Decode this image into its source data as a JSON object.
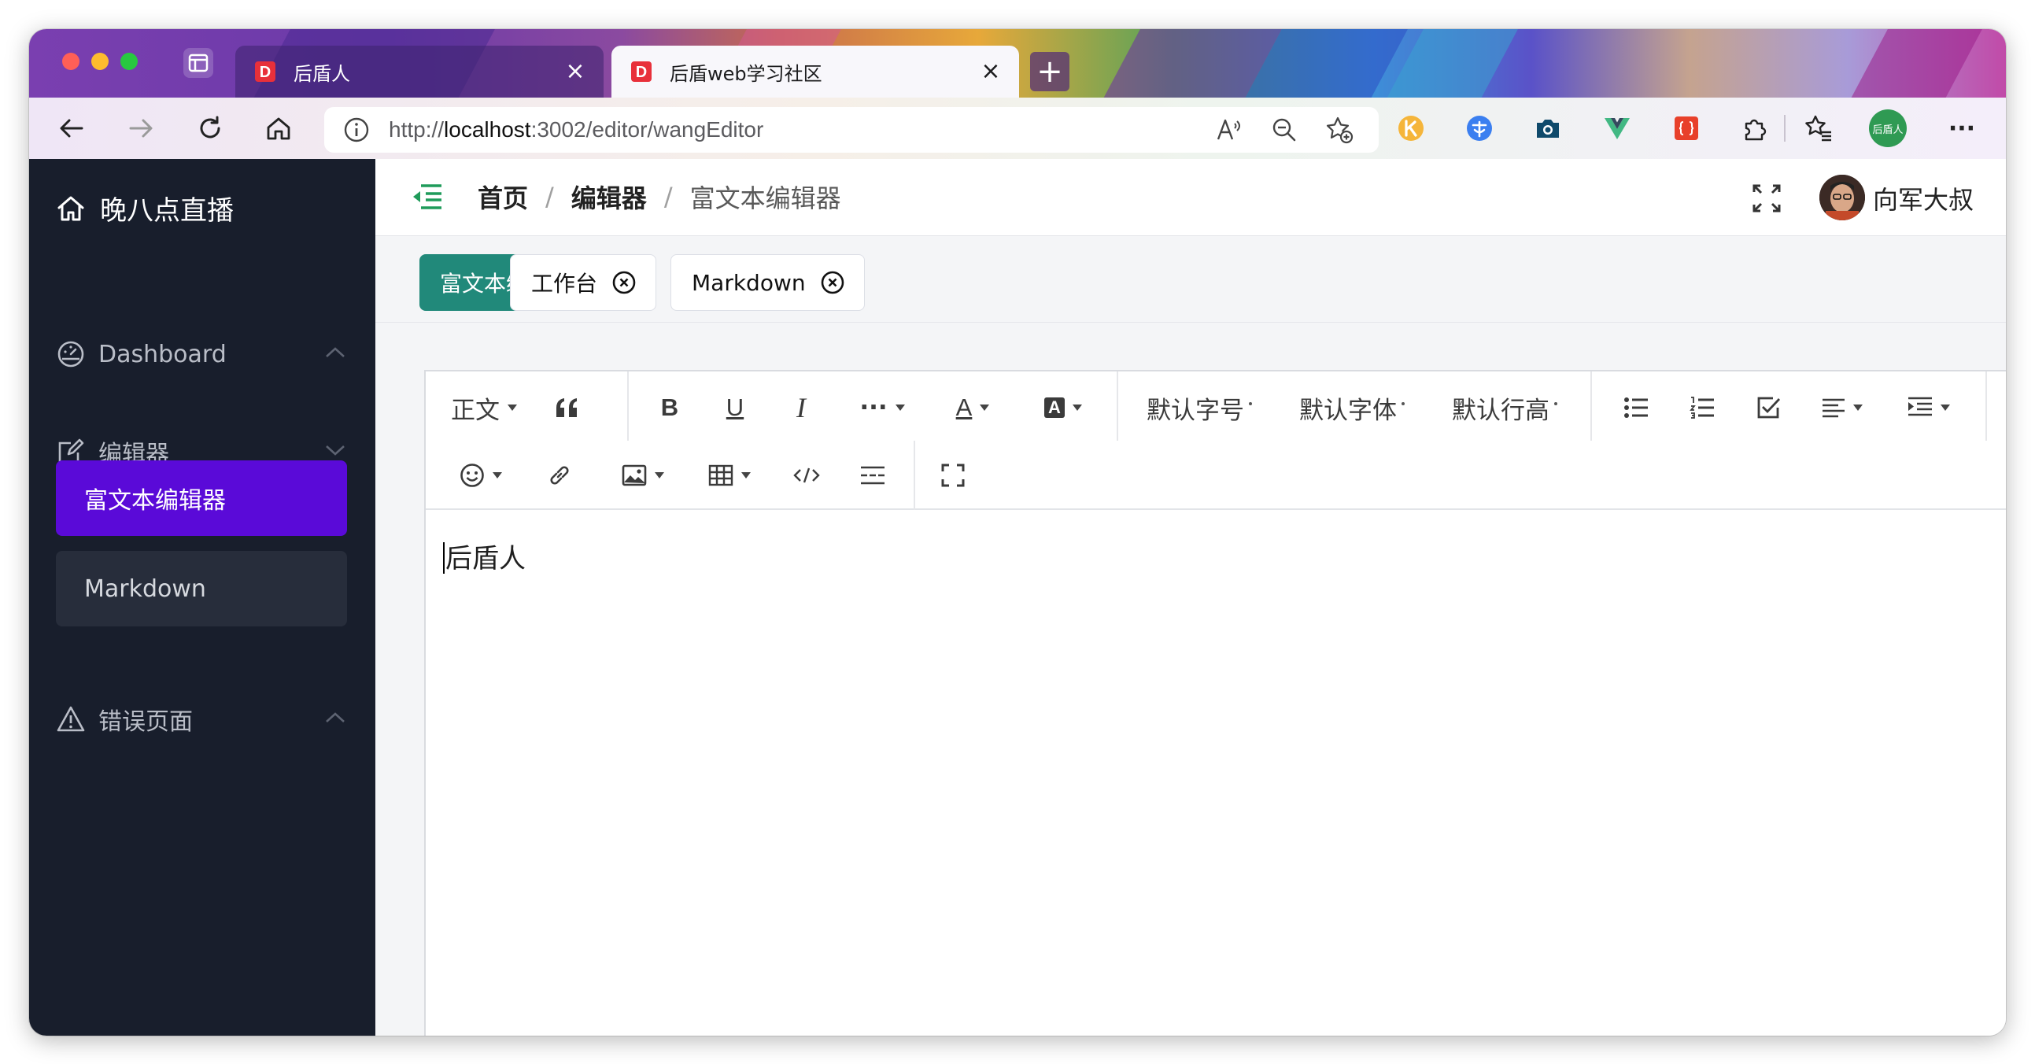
{
  "browser": {
    "tabs": [
      {
        "title": "后盾人",
        "active": false
      },
      {
        "title": "后盾web学习社区",
        "active": true
      }
    ],
    "new_tab_label": "+",
    "close_glyph": "×",
    "url": {
      "scheme": "http://",
      "host": "localhost",
      "rest": ":3002/editor/wangEditor"
    },
    "profile_label": "后盾人",
    "more_glyph": "···",
    "favicon_glyph": "D",
    "colors": {
      "favicon": "#e8303a"
    }
  },
  "sidebar": {
    "brand": "晚八点直播",
    "menus": [
      {
        "label": "Dashboard",
        "icon": "dashboard-icon",
        "expanded": false
      },
      {
        "label": "编辑器",
        "icon": "edit-icon",
        "expanded": true,
        "children": [
          {
            "label": "富文本编辑器",
            "active": true
          },
          {
            "label": "Markdown",
            "active": false
          }
        ]
      },
      {
        "label": "错误页面",
        "icon": "warning-icon",
        "expanded": false
      }
    ],
    "colors": {
      "background": "#181e2c",
      "active_item": "#5a0ad8"
    }
  },
  "header": {
    "breadcrumb": [
      "首页",
      "编辑器",
      "富文本编辑器"
    ],
    "breadcrumb_sep": "/",
    "user_name": "向军大叔"
  },
  "tags": [
    {
      "label": "富文本编辑器",
      "active": true
    },
    {
      "label": "工作台",
      "active": false
    },
    {
      "label": "Markdown",
      "active": false
    }
  ],
  "editor": {
    "toolbar": {
      "paragraph_style": "正文",
      "font_size": "默认字号",
      "font_family": "默认字体",
      "line_height": "默认行高",
      "more_glyph": "···",
      "font_color_glyph": "A",
      "bg_color_glyph": "A",
      "bold_glyph": "B",
      "underline_glyph": "U",
      "italic_glyph": "I"
    },
    "content": "后盾人"
  },
  "colors": {
    "tag_active": "#21897a",
    "fold_icon": "#1f9b5a"
  }
}
